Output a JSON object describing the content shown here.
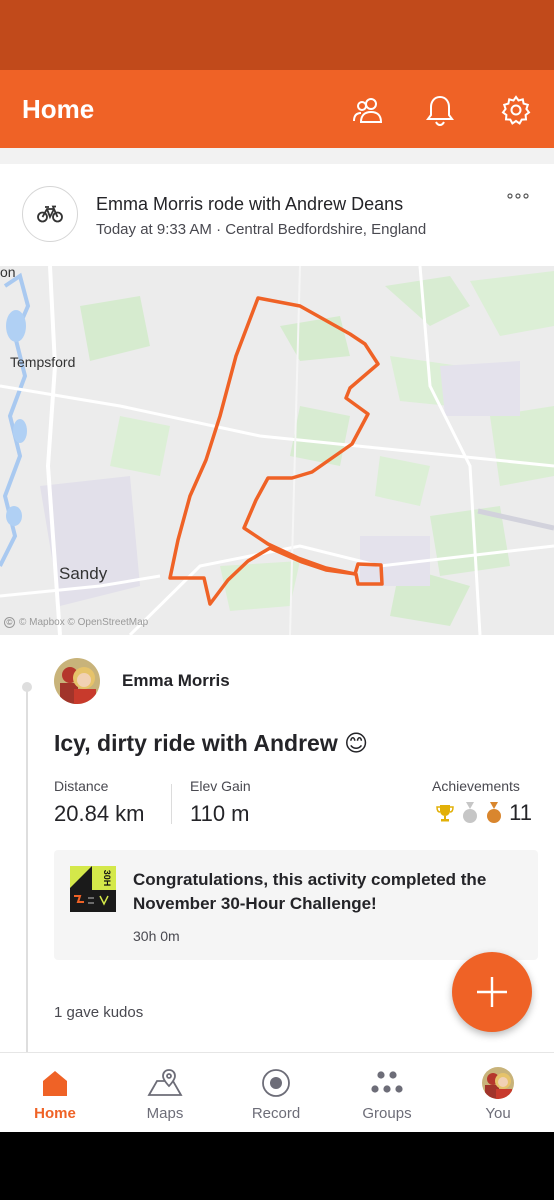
{
  "header": {
    "title": "Home",
    "icons": [
      "people-icon",
      "bell-icon",
      "gear-icon"
    ]
  },
  "activity": {
    "sport_icon": "bike-icon",
    "headline": "Emma Morris rode with Andrew Deans",
    "subline": "Today at 9:33 AM · Central Bedfordshire, England",
    "map": {
      "labels": {
        "top_left": "on",
        "tempsford": "Tempsford",
        "sandy": "Sandy"
      },
      "attribution": "© Mapbox © OpenStreetMap",
      "route_color": "#ef6226"
    },
    "athlete_name": "Emma Morris",
    "title": "Icy, dirty ride with Andrew 😊",
    "stats": {
      "distance_label": "Distance",
      "distance_value": "20.84 km",
      "elev_label": "Elev Gain",
      "elev_value": "110 m",
      "achievements_label": "Achievements",
      "achievements_count": "11"
    },
    "challenge": {
      "text": "Congratulations, this activity completed the November 30-Hour Challenge!",
      "duration": "30h 0m",
      "badge_text": "30H"
    },
    "kudos": "1 gave kudos"
  },
  "tabs": [
    {
      "label": "Home",
      "icon": "home-icon",
      "active": true
    },
    {
      "label": "Maps",
      "icon": "map-icon",
      "active": false
    },
    {
      "label": "Record",
      "icon": "record-icon",
      "active": false
    },
    {
      "label": "Groups",
      "icon": "groups-icon",
      "active": false
    },
    {
      "label": "You",
      "icon": "avatar",
      "active": false
    }
  ],
  "colors": {
    "brand": "#ef6226",
    "status_bar": "#c14a1b",
    "gold": "#e2b007",
    "silver": "#c6c6c6",
    "bronze": "#d9862e"
  }
}
